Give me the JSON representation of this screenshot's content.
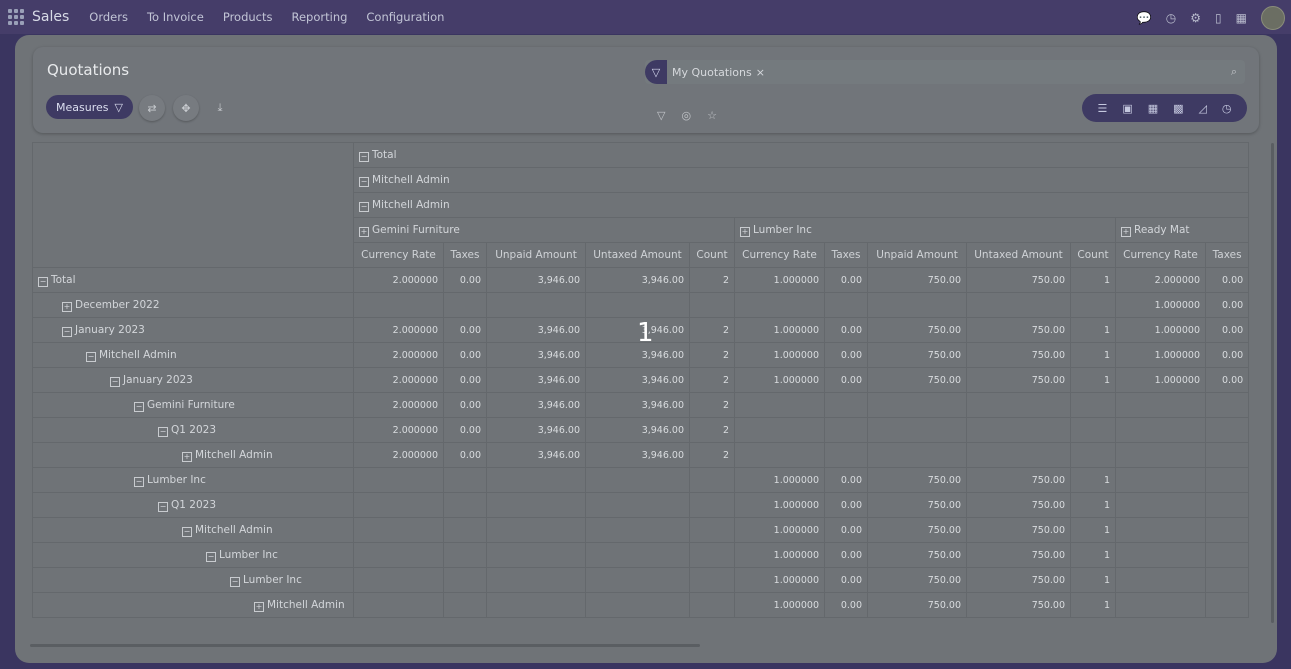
{
  "navbar": {
    "brand": "Sales",
    "menu": [
      "Orders",
      "To Invoice",
      "Products",
      "Reporting",
      "Configuration"
    ]
  },
  "control": {
    "title": "Quotations",
    "measures_label": "Measures",
    "facet": "My Quotations",
    "facet_remove": "×"
  },
  "overlay": {
    "step": "1"
  },
  "pivot": {
    "col_headers": {
      "total": "Total",
      "level1": "Mitchell Admin",
      "level2": "Mitchell Admin",
      "groups": [
        "Gemini Furniture",
        "Lumber Inc",
        "Ready Mat"
      ]
    },
    "measures": [
      "Currency Rate",
      "Taxes",
      "Unpaid Amount",
      "Untaxed Amount",
      "Count"
    ],
    "rows": [
      {
        "label": "Total",
        "indent": 0,
        "sign": "−",
        "values": [
          "2.000000",
          "0.00",
          "3,946.00",
          "3,946.00",
          "2",
          "1.000000",
          "0.00",
          "750.00",
          "750.00",
          "1",
          "2.000000",
          "0.00"
        ]
      },
      {
        "label": "December 2022",
        "indent": 1,
        "sign": "+",
        "values": [
          "",
          "",
          "",
          "",
          "",
          "",
          "",
          "",
          "",
          "",
          "1.000000",
          "0.00"
        ]
      },
      {
        "label": "January 2023",
        "indent": 1,
        "sign": "−",
        "values": [
          "2.000000",
          "0.00",
          "3,946.00",
          "3,946.00",
          "2",
          "1.000000",
          "0.00",
          "750.00",
          "750.00",
          "1",
          "1.000000",
          "0.00"
        ]
      },
      {
        "label": "Mitchell Admin",
        "indent": 2,
        "sign": "−",
        "values": [
          "2.000000",
          "0.00",
          "3,946.00",
          "3,946.00",
          "2",
          "1.000000",
          "0.00",
          "750.00",
          "750.00",
          "1",
          "1.000000",
          "0.00"
        ]
      },
      {
        "label": "January 2023",
        "indent": 3,
        "sign": "−",
        "values": [
          "2.000000",
          "0.00",
          "3,946.00",
          "3,946.00",
          "2",
          "1.000000",
          "0.00",
          "750.00",
          "750.00",
          "1",
          "1.000000",
          "0.00"
        ]
      },
      {
        "label": "Gemini Furniture",
        "indent": 4,
        "sign": "−",
        "values": [
          "2.000000",
          "0.00",
          "3,946.00",
          "3,946.00",
          "2",
          "",
          "",
          "",
          "",
          "",
          "",
          ""
        ]
      },
      {
        "label": "Q1 2023",
        "indent": 5,
        "sign": "−",
        "values": [
          "2.000000",
          "0.00",
          "3,946.00",
          "3,946.00",
          "2",
          "",
          "",
          "",
          "",
          "",
          "",
          ""
        ]
      },
      {
        "label": "Mitchell Admin",
        "indent": 6,
        "sign": "+",
        "values": [
          "2.000000",
          "0.00",
          "3,946.00",
          "3,946.00",
          "2",
          "",
          "",
          "",
          "",
          "",
          "",
          ""
        ]
      },
      {
        "label": "Lumber Inc",
        "indent": 4,
        "sign": "−",
        "values": [
          "",
          "",
          "",
          "",
          "",
          "1.000000",
          "0.00",
          "750.00",
          "750.00",
          "1",
          "",
          ""
        ]
      },
      {
        "label": "Q1 2023",
        "indent": 5,
        "sign": "−",
        "values": [
          "",
          "",
          "",
          "",
          "",
          "1.000000",
          "0.00",
          "750.00",
          "750.00",
          "1",
          "",
          ""
        ]
      },
      {
        "label": "Mitchell Admin",
        "indent": 6,
        "sign": "−",
        "values": [
          "",
          "",
          "",
          "",
          "",
          "1.000000",
          "0.00",
          "750.00",
          "750.00",
          "1",
          "",
          ""
        ]
      },
      {
        "label": "Lumber Inc",
        "indent": 7,
        "sign": "−",
        "values": [
          "",
          "",
          "",
          "",
          "",
          "1.000000",
          "0.00",
          "750.00",
          "750.00",
          "1",
          "",
          ""
        ]
      },
      {
        "label": "Lumber Inc",
        "indent": 8,
        "sign": "−",
        "values": [
          "",
          "",
          "",
          "",
          "",
          "1.000000",
          "0.00",
          "750.00",
          "750.00",
          "1",
          "",
          ""
        ]
      },
      {
        "label": "Mitchell Admin",
        "indent": 9,
        "sign": "+",
        "values": [
          "",
          "",
          "",
          "",
          "",
          "1.000000",
          "0.00",
          "750.00",
          "750.00",
          "1",
          "",
          ""
        ]
      }
    ]
  }
}
